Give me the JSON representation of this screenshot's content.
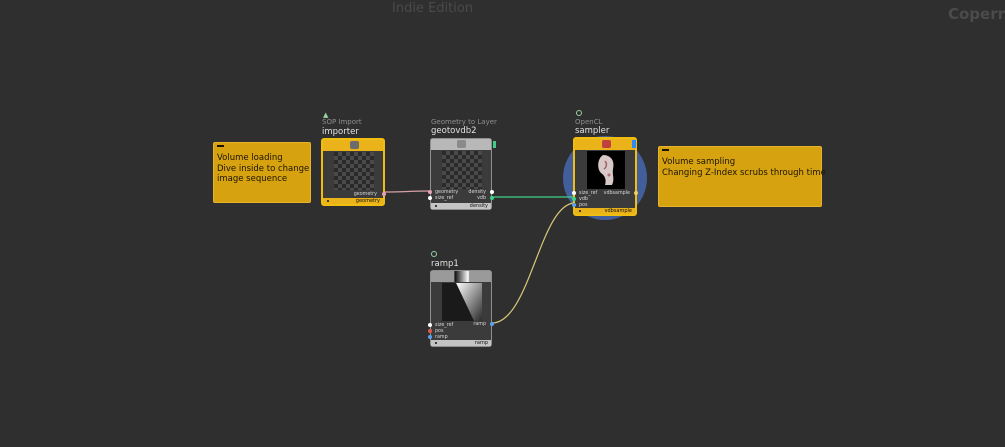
{
  "app": {
    "edition_watermark": "Indie Edition",
    "context_label": "Coperr"
  },
  "notes": [
    {
      "id": "volume-loading",
      "lines": [
        "Volume loading",
        "",
        "Dive inside to change",
        "image sequence"
      ]
    },
    {
      "id": "volume-sampling",
      "lines": [
        "Volume sampling",
        "",
        "Changing Z-Index scrubs through time"
      ]
    }
  ],
  "nodes": {
    "importer": {
      "type_label": "SOP Import",
      "name": "importer",
      "outputs": [
        "geometry"
      ],
      "footer": "geometry"
    },
    "geotovdb2": {
      "type_label": "Geometry to Layer",
      "name": "geotovdb2",
      "inputs": [
        "geometry",
        "size_ref"
      ],
      "outputs": [
        "density",
        "vdb"
      ],
      "footer": "density"
    },
    "sampler": {
      "type_label": "OpenCL",
      "name": "sampler",
      "inputs": [
        "size_ref",
        "vdb",
        "pos"
      ],
      "outputs": [
        "vdbsample"
      ],
      "footer": "vdbsample"
    },
    "ramp1": {
      "name": "ramp1",
      "inputs": [
        "size_ref",
        "pos",
        "ramp"
      ],
      "outputs": [
        "ramp"
      ],
      "footer": "ramp"
    }
  },
  "colors": {
    "background": "#2f2f2f",
    "note": "#d6a20f",
    "selected": "#f0be10",
    "wire_geometry": "#d7a0a8",
    "wire_vdb": "#3ed088",
    "wire_ramp": "#d8c878",
    "port_blue": "#5aa0f0",
    "port_red": "#e05a4a",
    "port_white": "#ffffff",
    "port_green": "#3ed088",
    "port_yellow": "#f0d050",
    "port_pink": "#e6a0b8"
  }
}
